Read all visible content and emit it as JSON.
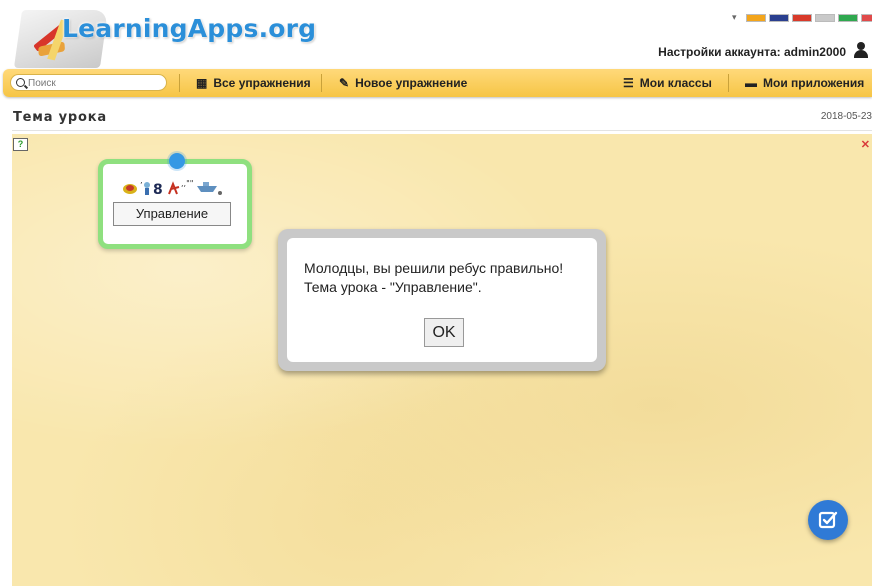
{
  "header": {
    "logo_text": "LearningApps.org",
    "account_label": "Настройки аккаунта: admin2000",
    "flag_colors": [
      "#f3a51b",
      "#2a3f8f",
      "#d83a2a",
      "#c9c9c9",
      "#2fa84f",
      "#e04a4a"
    ]
  },
  "nav": {
    "search_placeholder": "Поиск",
    "all_exercises": "Все упражнения",
    "new_exercise": "Новое упражнение",
    "my_classes": "Мои классы",
    "my_apps": "Мои приложения"
  },
  "page": {
    "title": "Тема урока",
    "date": "2018-05-23"
  },
  "rebus": {
    "answer": "Управление"
  },
  "dialog": {
    "line1": "Молодцы, вы решили ребус правильно!",
    "line2": "Тема урока - \"Управление\".",
    "ok_label": "OK"
  },
  "colors": {
    "accent": "#2f7ad6",
    "navbar": "#f6c545",
    "background": "#f9e7ad",
    "card_border": "#8fe07f"
  }
}
